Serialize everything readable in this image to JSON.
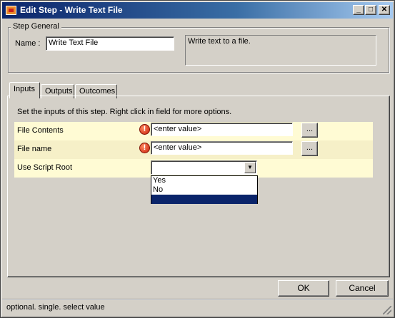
{
  "window": {
    "title": "Edit Step - Write Text File",
    "controls": {
      "minimize": "_",
      "maximize": "□",
      "close": "✕"
    }
  },
  "step_general": {
    "legend": "Step General",
    "name_label": "Name :",
    "name_value": "Write Text File",
    "description": "Write text to a file."
  },
  "tabs": [
    {
      "label": "Inputs"
    },
    {
      "label": "Outputs"
    },
    {
      "label": "Outcomes"
    }
  ],
  "inputs_panel": {
    "hint": "Set the inputs of this step.  Right click in field for more options.",
    "rows": [
      {
        "label": "File Contents",
        "value": "<enter value>",
        "browse": "..."
      },
      {
        "label": "File name",
        "value": "<enter value>",
        "browse": "..."
      },
      {
        "label": "Use Script Root",
        "value": ""
      }
    ],
    "dropdown_options": [
      "Yes",
      "No",
      ""
    ],
    "error_glyph": "!"
  },
  "buttons": {
    "ok": "OK",
    "cancel": "Cancel"
  },
  "status": {
    "text": "optional. single. select value"
  },
  "icons": {
    "app": "app-icon",
    "error": "error-icon",
    "dropdown_arrow": "▼"
  }
}
